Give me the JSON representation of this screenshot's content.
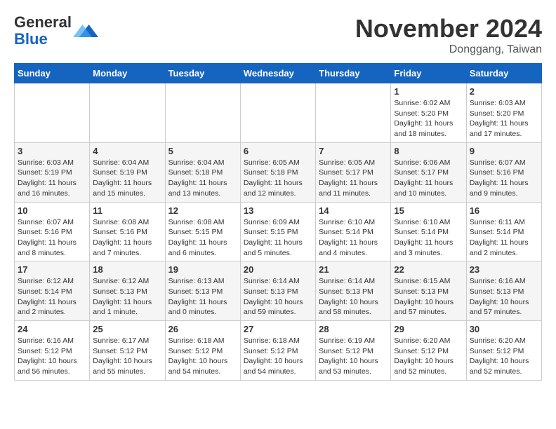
{
  "header": {
    "logo_general": "General",
    "logo_blue": "Blue",
    "month_title": "November 2024",
    "location": "Donggang, Taiwan"
  },
  "days_of_week": [
    "Sunday",
    "Monday",
    "Tuesday",
    "Wednesday",
    "Thursday",
    "Friday",
    "Saturday"
  ],
  "weeks": [
    [
      {
        "day": "",
        "info": ""
      },
      {
        "day": "",
        "info": ""
      },
      {
        "day": "",
        "info": ""
      },
      {
        "day": "",
        "info": ""
      },
      {
        "day": "",
        "info": ""
      },
      {
        "day": "1",
        "info": "Sunrise: 6:02 AM\nSunset: 5:20 PM\nDaylight: 11 hours and 18 minutes."
      },
      {
        "day": "2",
        "info": "Sunrise: 6:03 AM\nSunset: 5:20 PM\nDaylight: 11 hours and 17 minutes."
      }
    ],
    [
      {
        "day": "3",
        "info": "Sunrise: 6:03 AM\nSunset: 5:19 PM\nDaylight: 11 hours and 16 minutes."
      },
      {
        "day": "4",
        "info": "Sunrise: 6:04 AM\nSunset: 5:19 PM\nDaylight: 11 hours and 15 minutes."
      },
      {
        "day": "5",
        "info": "Sunrise: 6:04 AM\nSunset: 5:18 PM\nDaylight: 11 hours and 13 minutes."
      },
      {
        "day": "6",
        "info": "Sunrise: 6:05 AM\nSunset: 5:18 PM\nDaylight: 11 hours and 12 minutes."
      },
      {
        "day": "7",
        "info": "Sunrise: 6:05 AM\nSunset: 5:17 PM\nDaylight: 11 hours and 11 minutes."
      },
      {
        "day": "8",
        "info": "Sunrise: 6:06 AM\nSunset: 5:17 PM\nDaylight: 11 hours and 10 minutes."
      },
      {
        "day": "9",
        "info": "Sunrise: 6:07 AM\nSunset: 5:16 PM\nDaylight: 11 hours and 9 minutes."
      }
    ],
    [
      {
        "day": "10",
        "info": "Sunrise: 6:07 AM\nSunset: 5:16 PM\nDaylight: 11 hours and 8 minutes."
      },
      {
        "day": "11",
        "info": "Sunrise: 6:08 AM\nSunset: 5:16 PM\nDaylight: 11 hours and 7 minutes."
      },
      {
        "day": "12",
        "info": "Sunrise: 6:08 AM\nSunset: 5:15 PM\nDaylight: 11 hours and 6 minutes."
      },
      {
        "day": "13",
        "info": "Sunrise: 6:09 AM\nSunset: 5:15 PM\nDaylight: 11 hours and 5 minutes."
      },
      {
        "day": "14",
        "info": "Sunrise: 6:10 AM\nSunset: 5:14 PM\nDaylight: 11 hours and 4 minutes."
      },
      {
        "day": "15",
        "info": "Sunrise: 6:10 AM\nSunset: 5:14 PM\nDaylight: 11 hours and 3 minutes."
      },
      {
        "day": "16",
        "info": "Sunrise: 6:11 AM\nSunset: 5:14 PM\nDaylight: 11 hours and 2 minutes."
      }
    ],
    [
      {
        "day": "17",
        "info": "Sunrise: 6:12 AM\nSunset: 5:14 PM\nDaylight: 11 hours and 2 minutes."
      },
      {
        "day": "18",
        "info": "Sunrise: 6:12 AM\nSunset: 5:13 PM\nDaylight: 11 hours and 1 minute."
      },
      {
        "day": "19",
        "info": "Sunrise: 6:13 AM\nSunset: 5:13 PM\nDaylight: 11 hours and 0 minutes."
      },
      {
        "day": "20",
        "info": "Sunrise: 6:14 AM\nSunset: 5:13 PM\nDaylight: 10 hours and 59 minutes."
      },
      {
        "day": "21",
        "info": "Sunrise: 6:14 AM\nSunset: 5:13 PM\nDaylight: 10 hours and 58 minutes."
      },
      {
        "day": "22",
        "info": "Sunrise: 6:15 AM\nSunset: 5:13 PM\nDaylight: 10 hours and 57 minutes."
      },
      {
        "day": "23",
        "info": "Sunrise: 6:16 AM\nSunset: 5:13 PM\nDaylight: 10 hours and 57 minutes."
      }
    ],
    [
      {
        "day": "24",
        "info": "Sunrise: 6:16 AM\nSunset: 5:12 PM\nDaylight: 10 hours and 56 minutes."
      },
      {
        "day": "25",
        "info": "Sunrise: 6:17 AM\nSunset: 5:12 PM\nDaylight: 10 hours and 55 minutes."
      },
      {
        "day": "26",
        "info": "Sunrise: 6:18 AM\nSunset: 5:12 PM\nDaylight: 10 hours and 54 minutes."
      },
      {
        "day": "27",
        "info": "Sunrise: 6:18 AM\nSunset: 5:12 PM\nDaylight: 10 hours and 54 minutes."
      },
      {
        "day": "28",
        "info": "Sunrise: 6:19 AM\nSunset: 5:12 PM\nDaylight: 10 hours and 53 minutes."
      },
      {
        "day": "29",
        "info": "Sunrise: 6:20 AM\nSunset: 5:12 PM\nDaylight: 10 hours and 52 minutes."
      },
      {
        "day": "30",
        "info": "Sunrise: 6:20 AM\nSunset: 5:12 PM\nDaylight: 10 hours and 52 minutes."
      }
    ]
  ]
}
